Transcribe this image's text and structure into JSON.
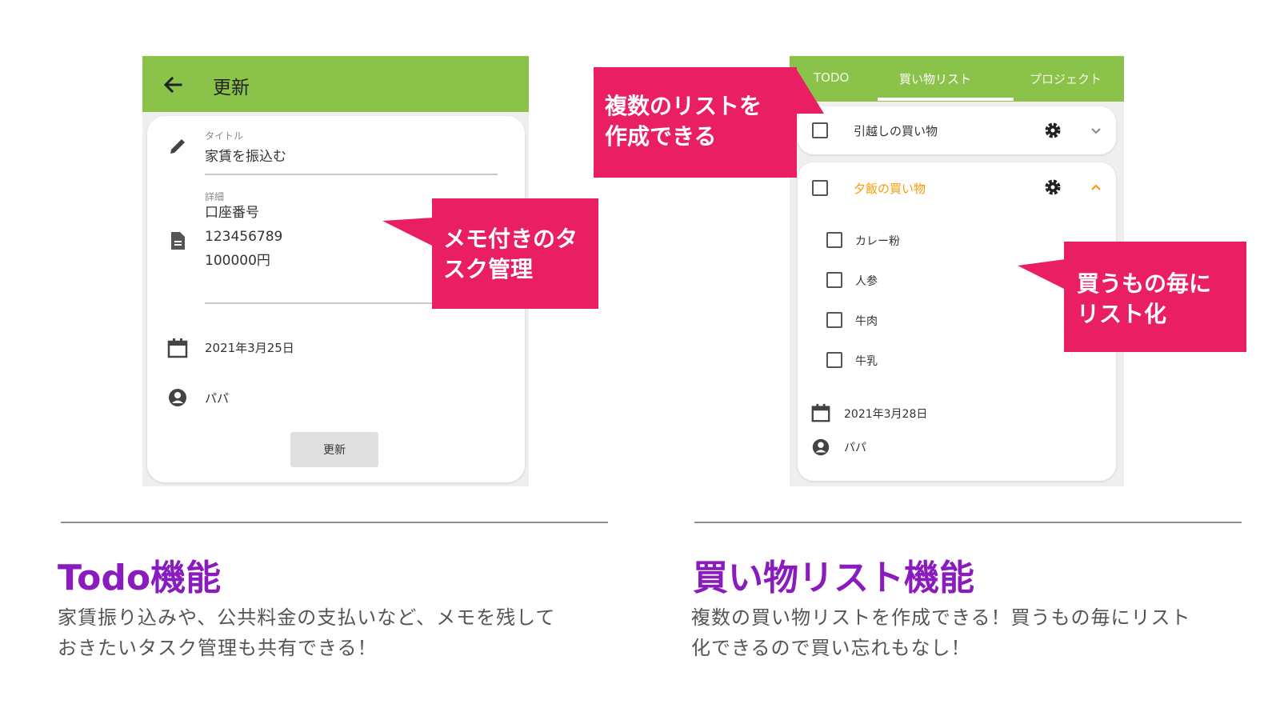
{
  "colors": {
    "appbar": "#8bc34a",
    "callout": "#e91e63",
    "title": "#8a1bbd",
    "accent_orange": "#ff9800"
  },
  "todo_screen": {
    "appbar_title": "更新",
    "back_icon": "arrow-back-icon",
    "title_field": {
      "label": "タイトル",
      "value": "家賃を振込む"
    },
    "detail_field": {
      "label": "詳細",
      "lines": [
        "口座番号",
        "123456789",
        "100000円"
      ]
    },
    "date": "2021年3月25日",
    "person": "パパ",
    "update_button": "更新"
  },
  "shopping_screen": {
    "tabs": [
      {
        "label": "TODO"
      },
      {
        "label": "買い物リスト"
      },
      {
        "label": "プロジェクト"
      }
    ],
    "active_tab": "買い物リスト",
    "list1": {
      "name": "引越しの買い物"
    },
    "list2": {
      "name": "夕飯の買い物",
      "items": [
        "カレー粉",
        "人参",
        "牛肉",
        "牛乳"
      ],
      "date": "2021年3月28日",
      "person": "パパ"
    }
  },
  "callouts": {
    "memo": "メモ付きのタスク管理",
    "memo_lines": [
      "メモ付きのタ",
      "スク管理"
    ],
    "multi_list": "複数のリストを作成できる",
    "multi_list_lines": [
      "複数のリストを",
      "作成できる"
    ],
    "per_item": "買うもの毎にリスト化",
    "per_item_lines": [
      "買うもの毎に",
      "リスト化"
    ]
  },
  "features": {
    "todo": {
      "title": "Todo機能",
      "desc_lines": [
        "家賃振り込みや、公共料金の支払いなど、メモを残して",
        "おきたいタスク管理も共有できる！"
      ]
    },
    "shopping": {
      "title": "買い物リスト機能",
      "desc_lines": [
        "複数の買い物リストを作成できる！買うもの毎にリスト",
        "化できるので買い忘れもなし！"
      ]
    }
  }
}
